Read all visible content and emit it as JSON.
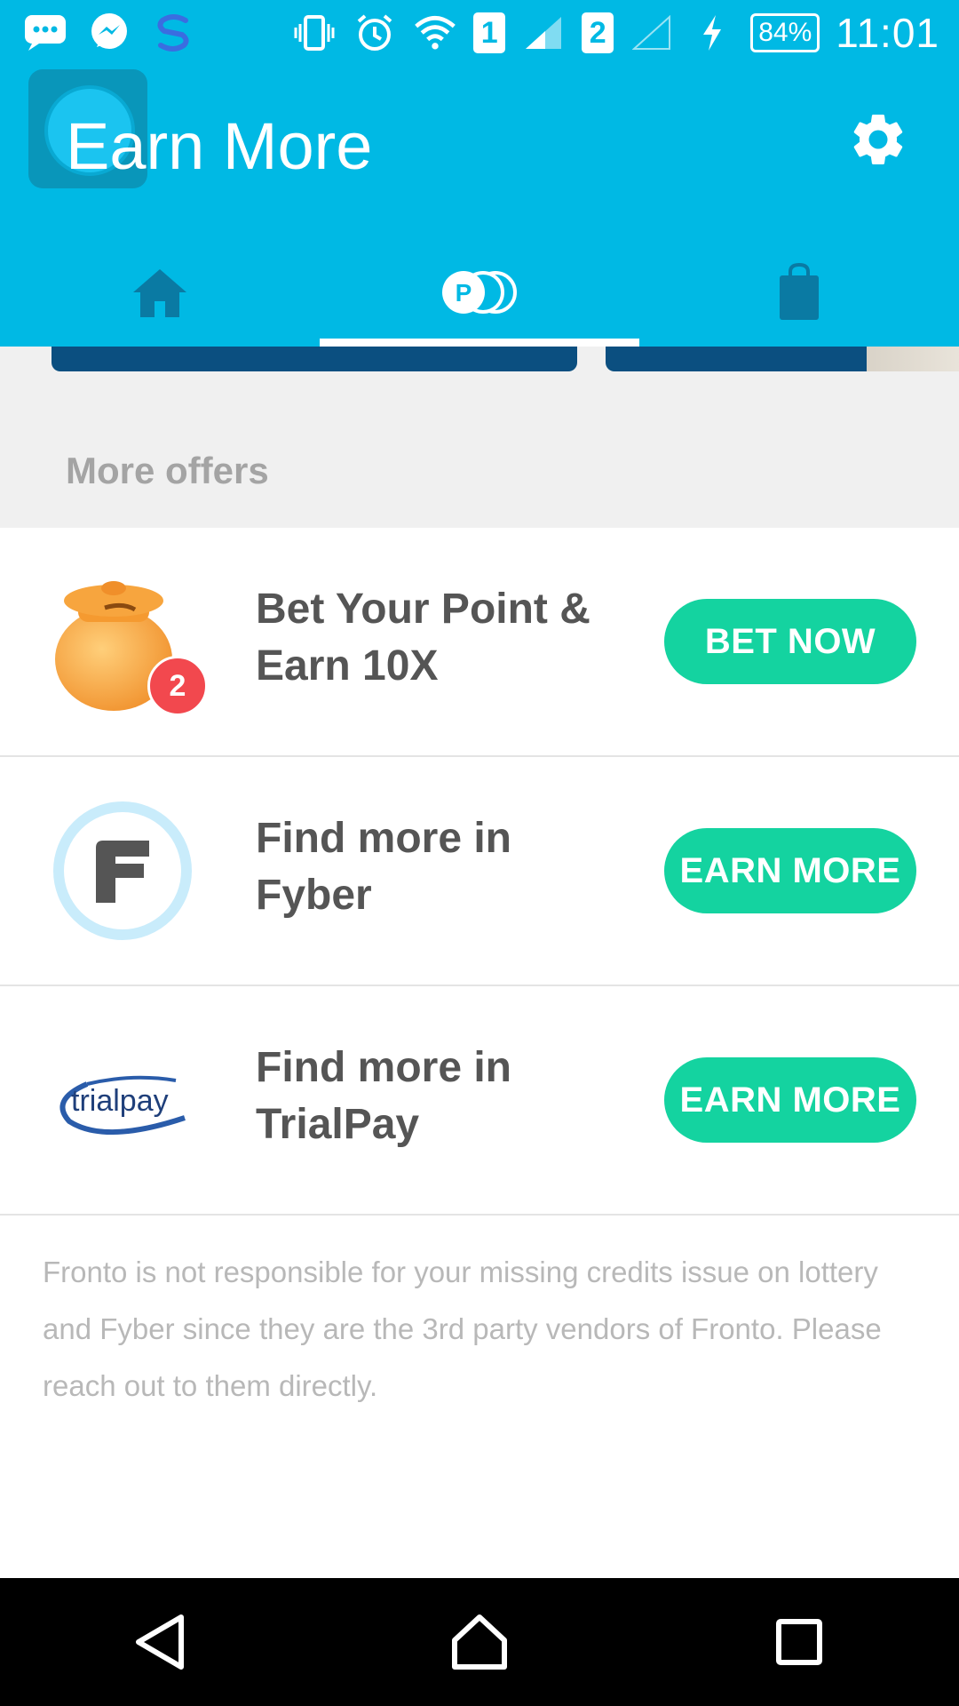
{
  "status_bar": {
    "battery": "84%",
    "time": "11:01",
    "sim1": "1",
    "sim2": "2",
    "icons": [
      "messages-icon",
      "messenger-icon",
      "s-app-icon",
      "vibrate-icon",
      "alarm-icon",
      "wifi-icon",
      "signal-icon",
      "charging-icon"
    ]
  },
  "app_bar": {
    "title": "Earn More",
    "tabs": [
      "home-icon",
      "points-icon",
      "shop-bag-icon"
    ],
    "active_tab": 1,
    "color": "#00b9e4"
  },
  "section": {
    "title": "More offers"
  },
  "offers": [
    {
      "title": "Bet Your Point & Earn 10X",
      "button": "BET NOW",
      "icon": "pot-icon",
      "badge": "2"
    },
    {
      "title": "Find more in Fyber",
      "button": "EARN MORE",
      "icon": "fyber-logo-icon"
    },
    {
      "title": "Find more in TrialPay",
      "button": "EARN MORE",
      "icon": "trialpay-logo-icon",
      "logo_text": "trialpay"
    }
  ],
  "disclaimer": "Fronto is not responsible for your missing credits issue on lottery and Fyber since they are the 3rd party vendors of Fronto. Please reach out to them directly.",
  "accent_color": "#14d3a0"
}
